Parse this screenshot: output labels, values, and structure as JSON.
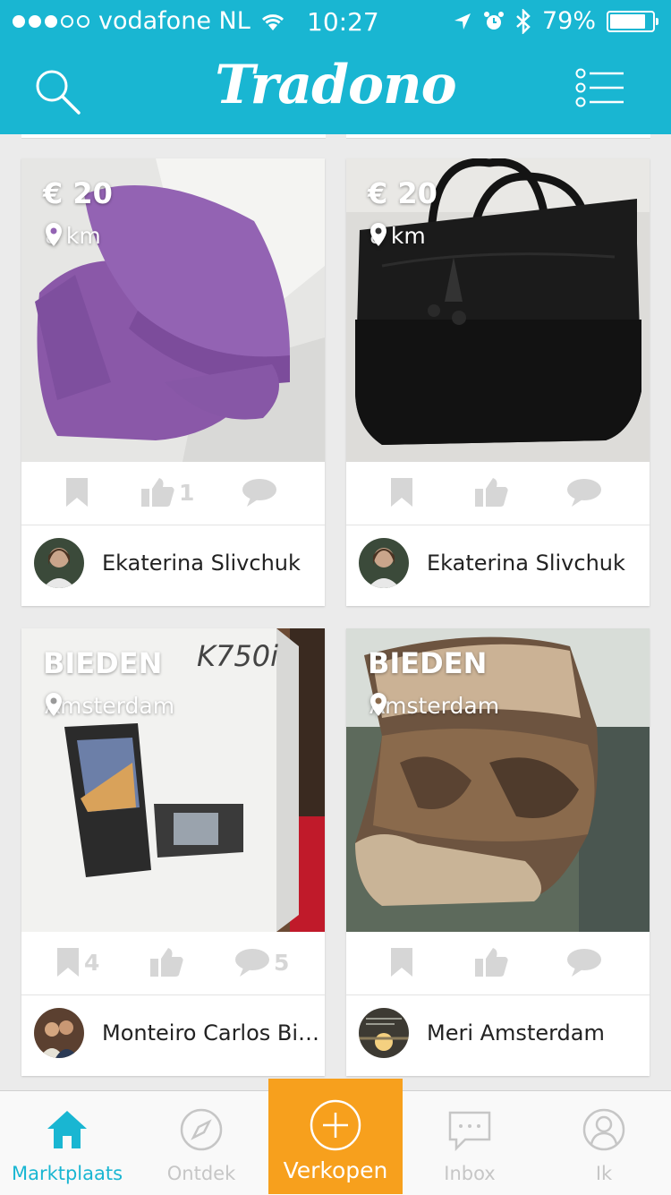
{
  "status_bar": {
    "carrier": "vodafone NL",
    "time": "10:27",
    "battery": "79%"
  },
  "header": {
    "logo": "Tradono",
    "search_icon": "search-icon",
    "menu_icon": "list-menu-icon"
  },
  "listings": [
    {
      "price": "€ 20",
      "location": "8 km",
      "likes": "1",
      "saves": "",
      "comments": "",
      "seller": "Ekaterina Slivchuk",
      "image": "purple-hat-and-gloves"
    },
    {
      "price": "€ 20",
      "location": "8 km",
      "likes": "",
      "saves": "",
      "comments": "",
      "seller": "Ekaterina Slivchuk",
      "image": "black-leather-handbag"
    },
    {
      "price": "BIEDEN",
      "location": "Amsterdam",
      "likes": "",
      "saves": "4",
      "comments": "5",
      "seller": "Monteiro Carlos Big...",
      "image": "sony-ericsson-k750i-box",
      "box_label": "K750i"
    },
    {
      "price": "BIEDEN",
      "location": "Amsterdam",
      "likes": "",
      "saves": "",
      "comments": "",
      "seller": "Meri Amsterdam",
      "image": "fur-boot"
    }
  ],
  "tabbar": {
    "items": [
      {
        "label": "Marktplaats",
        "icon": "home-icon",
        "active": true
      },
      {
        "label": "Ontdek",
        "icon": "compass-icon",
        "active": false
      },
      {
        "label": "Verkopen",
        "icon": "plus-circle-icon",
        "active": false
      },
      {
        "label": "Inbox",
        "icon": "chat-icon",
        "active": false
      },
      {
        "label": "Ik",
        "icon": "profile-icon",
        "active": false
      }
    ]
  },
  "colors": {
    "brand": "#19b6d2",
    "sell": "#f7a01d",
    "background": "#ebebeb"
  }
}
